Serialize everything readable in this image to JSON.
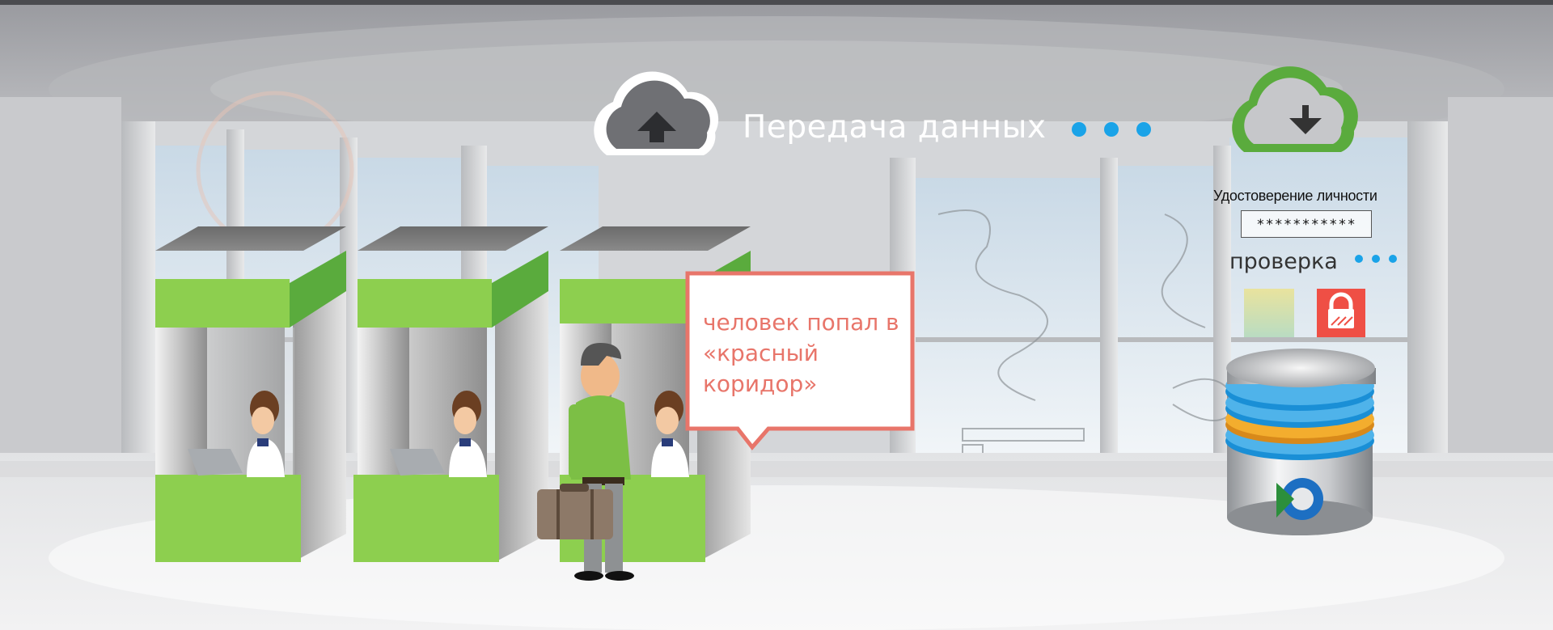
{
  "header": {
    "transfer_title": "Передача данных"
  },
  "verification": {
    "id_label": "Удостоверение личности",
    "id_value": "***********",
    "check_label": "проверка"
  },
  "callout": {
    "text": "человек попал в «красный коридор»"
  },
  "icons": {
    "upload": "cloud-upload-icon",
    "download": "cloud-download-icon",
    "lock": "lock-icon",
    "database": "database-icon"
  },
  "colors": {
    "booth_green": "#8dcf4f",
    "cloud_green": "#5aab3d",
    "dots_blue": "#1aa3e8",
    "alert_red": "#ef4f45",
    "callout_border": "#e8756a"
  }
}
